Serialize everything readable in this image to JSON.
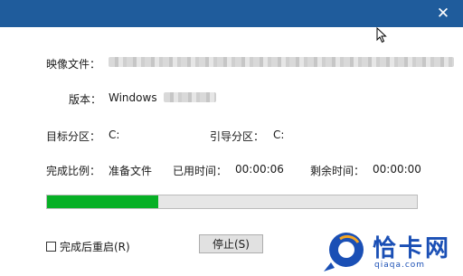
{
  "window": {
    "close_glyph": "✕"
  },
  "fields": {
    "image_file_label": "映像文件：",
    "version_label": "版本：",
    "version_value": "Windows",
    "target_label": "目标分区：",
    "target_value": "C:",
    "boot_label": "引导分区：",
    "boot_value": "C:",
    "ratio_label": "完成比例：",
    "ratio_value": "准备文件",
    "elapsed_label": "已用时间：",
    "elapsed_value": "00:00:06",
    "remaining_label": "剩余时间：",
    "remaining_value": "00:00:00"
  },
  "progress": {
    "fraction": 0.3,
    "color": "#06b025"
  },
  "footer": {
    "restart_label": "完成后重启(R)",
    "restart_checked": false,
    "stop_label": "停止(S)"
  },
  "watermark": {
    "text": "恰卡网",
    "url": "qiaqa.com"
  },
  "colors": {
    "titlebar": "#1f5c9c",
    "accent": "#1a4fb5"
  }
}
